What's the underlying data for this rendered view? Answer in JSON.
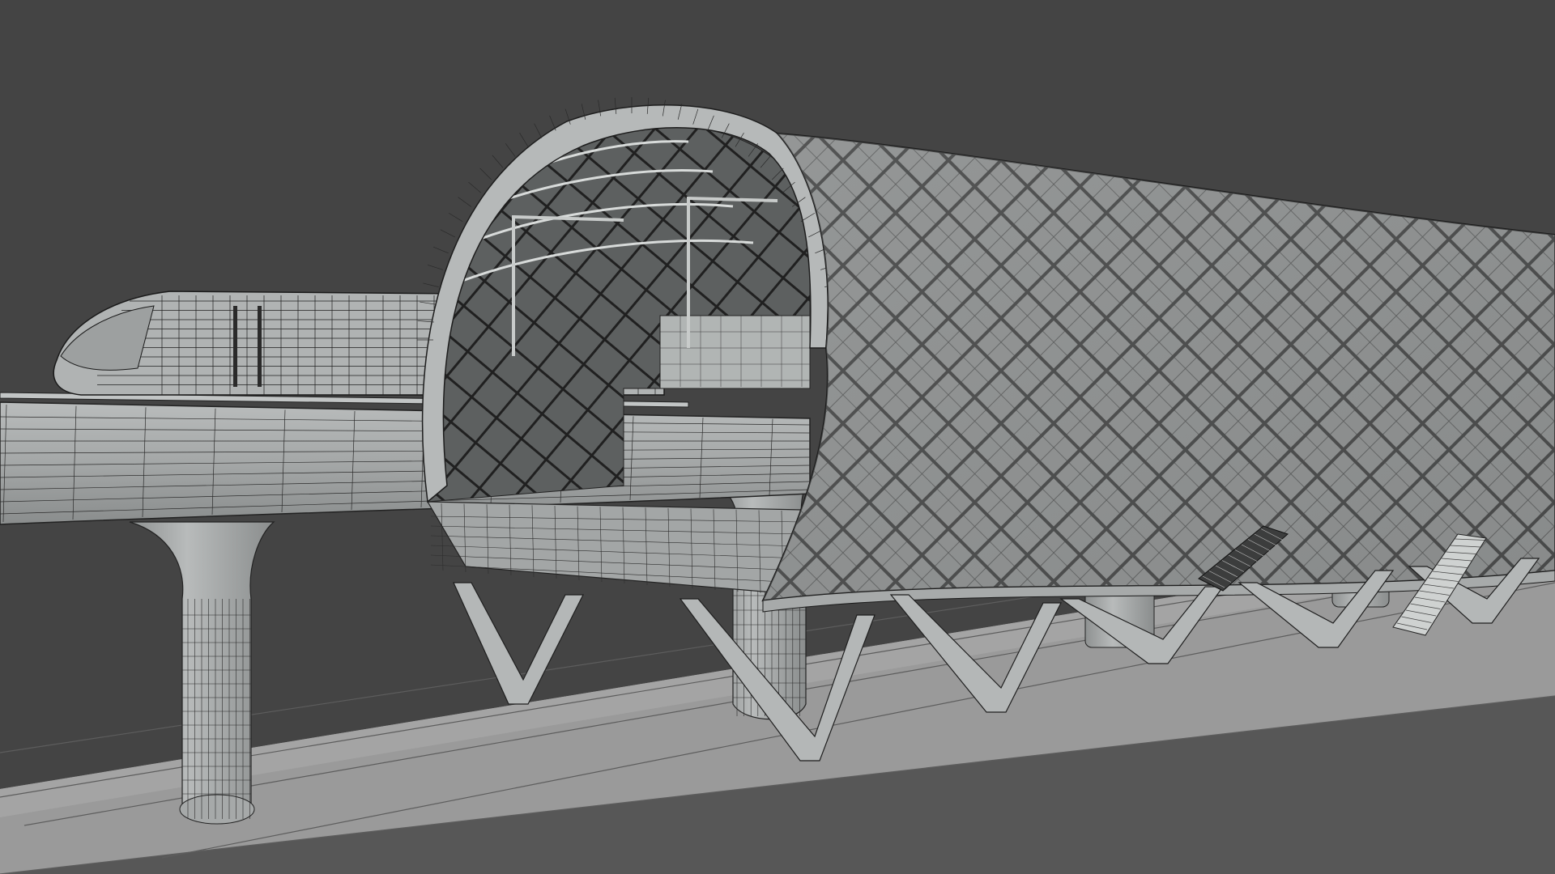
{
  "scene": {
    "subject": "",
    "colors": {
      "background": "#444444",
      "ground": "#9a9a9a",
      "ground_band": "#a6a6a6",
      "surface_light": "#b4b7b7",
      "surface_mid": "#9b9e9e",
      "surface_dark": "#7d8080",
      "wire": "#1c1c1c",
      "lattice_fill": "#8e8f8f",
      "interior": "#565959",
      "highlight": "#e8ebea"
    }
  }
}
